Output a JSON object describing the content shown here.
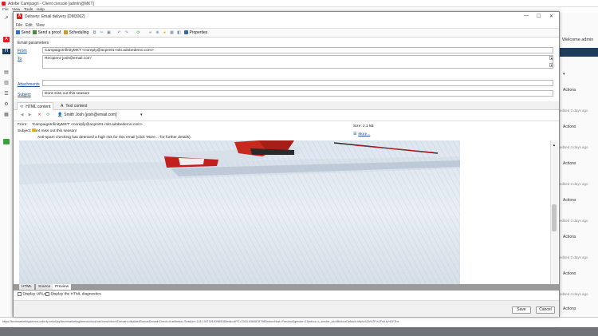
{
  "background": {
    "app_title": "Adobe Campaign - Client console [admin@MKT]",
    "menu": [
      "File",
      "View",
      "Tools",
      "Help"
    ],
    "welcome": "Welcome admin",
    "actions_label": "Actions",
    "edited_label": "edited 3 days ago",
    "status_url": "https://techmarketingdemos.ontirdy.net/nl/jsp/techmarketingdemos/ubus/nav/nms/inbox/iDomain=disabledBomosDomainCheck=trueBmbox.Session=1241.50702103989188mbbozPC=2303.6360878798BmboxHost=Preview&gender=1&mbox=c_sender_clickBmboxDefault=https%3A%2F%2Fsb.ty%2F3hx"
  },
  "dialog": {
    "title": "Delivery: Email delivery (DM3062)",
    "menu": [
      "File",
      "Edit",
      "View"
    ],
    "toolbar": {
      "send": "Send",
      "send_proof": "Send a proof",
      "scheduling": "Scheduling",
      "properties": "Properties"
    },
    "email_params": {
      "header": "Email parameters",
      "from_label": "From",
      "from_value": "CampaignInfinityMKT <noreply@acpm01-mkt.adobedemo.com>",
      "to_label": "To",
      "to_value": "Recipient 'josh@email.com'",
      "attachments_label": "Attachments",
      "subject_label": "Subject",
      "subject_value": "Dont miss out this season!"
    },
    "tabs": {
      "html": "HTML content",
      "text": "Text content"
    },
    "preview": {
      "recipient": "Smith Josh (josh@email.com)",
      "from_label": "From:",
      "from_value": "'CampaignInfinityMKT' <noreply@acpm01-mkt.adobedemo.com>",
      "subject_label": "Subject:",
      "subject_value": "Dont miss out this season!",
      "warning": "Anti-spam checking has detected a high risk for this email (click 'More...' for further details).",
      "size_label": "Size:",
      "size_value": "2.1 kB",
      "more_link": "More..."
    },
    "bottom_tabs": [
      "HTML",
      "Source",
      "Preview"
    ],
    "checkboxes": {
      "display_urls": "Display URLs",
      "diagnostics": "Display the HTML diagnostics"
    },
    "footer": {
      "save": "Save",
      "cancel": "Cancel"
    }
  },
  "colors": {
    "brand_red": "#e41d1d",
    "link_blue": "#1a4b9b",
    "nav_blue": "#1d3d5e"
  }
}
